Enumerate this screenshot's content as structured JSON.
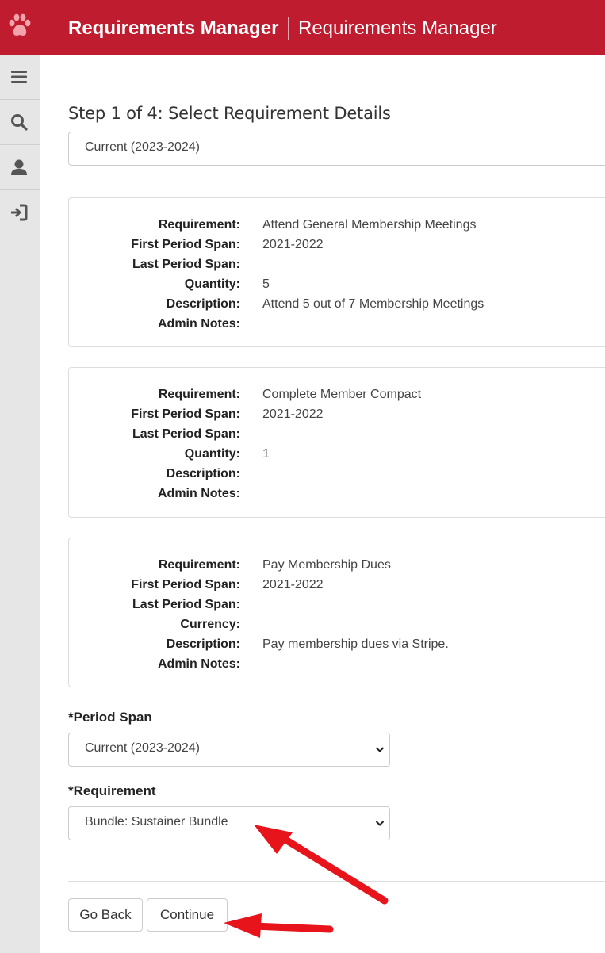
{
  "header": {
    "title": "Requirements Manager",
    "subtitle": "Requirements Manager",
    "logo_icon": "paw-icon"
  },
  "sidebar": {
    "items": [
      {
        "icon": "menu-icon"
      },
      {
        "icon": "search-icon"
      },
      {
        "icon": "user-icon"
      },
      {
        "icon": "sign-in-icon"
      }
    ]
  },
  "step_title": "Step 1 of 4: Select Requirement Details",
  "current_period": "Current (2023-2024)",
  "cards": [
    {
      "rows": [
        {
          "label": "Requirement:",
          "value": "Attend General Membership Meetings"
        },
        {
          "label": "First Period Span:",
          "value": "2021-2022"
        },
        {
          "label": "Last Period Span:",
          "value": ""
        },
        {
          "label": "Quantity:",
          "value": "5"
        },
        {
          "label": "Description:",
          "value": "Attend 5 out of 7 Membership Meetings"
        },
        {
          "label": "Admin Notes:",
          "value": ""
        }
      ]
    },
    {
      "rows": [
        {
          "label": "Requirement:",
          "value": "Complete Member Compact"
        },
        {
          "label": "First Period Span:",
          "value": "2021-2022"
        },
        {
          "label": "Last Period Span:",
          "value": ""
        },
        {
          "label": "Quantity:",
          "value": "1"
        },
        {
          "label": "Description:",
          "value": ""
        },
        {
          "label": "Admin Notes:",
          "value": ""
        }
      ]
    },
    {
      "rows": [
        {
          "label": "Requirement:",
          "value": "Pay Membership Dues"
        },
        {
          "label": "First Period Span:",
          "value": "2021-2022"
        },
        {
          "label": "Last Period Span:",
          "value": ""
        },
        {
          "label": "Currency:",
          "value": ""
        },
        {
          "label": "Description:",
          "value": "Pay membership dues via Stripe."
        },
        {
          "label": "Admin Notes:",
          "value": ""
        }
      ]
    }
  ],
  "form": {
    "period_span_label": "*Period Span",
    "period_span_value": "Current (2023-2024)",
    "requirement_label": "*Requirement",
    "requirement_value": "Bundle: Sustainer Bundle"
  },
  "buttons": {
    "back": "Go Back",
    "continue": "Continue"
  },
  "colors": {
    "brand": "#c01c2f",
    "annotation_arrow": "#e8141c"
  }
}
